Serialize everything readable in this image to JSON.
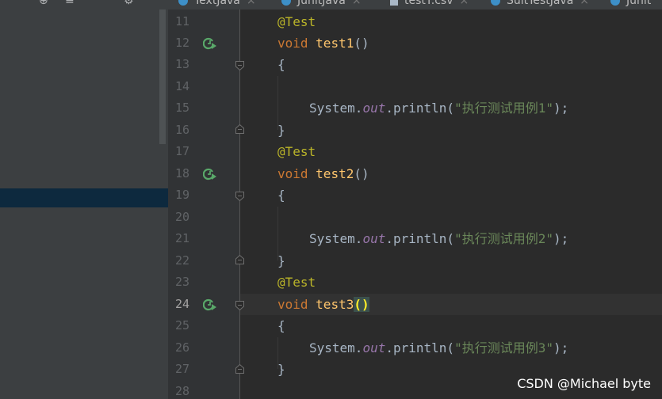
{
  "tabs": [
    {
      "label": "TextJava",
      "icon": "class-icon"
    },
    {
      "label": "JunitJava",
      "icon": "class-icon",
      "active": true
    },
    {
      "label": "testT.csv",
      "icon": "file-icon"
    },
    {
      "label": "SuitTestJava",
      "icon": "class-icon"
    },
    {
      "label": "Junit",
      "icon": "class-icon"
    }
  ],
  "toolbar_icons": [
    "globe-icon",
    "collapse-icon",
    "expand-icon",
    "settings-icon"
  ],
  "lines": [
    {
      "num": "11"
    },
    {
      "num": "12"
    },
    {
      "num": "13"
    },
    {
      "num": "14"
    },
    {
      "num": "15"
    },
    {
      "num": "16"
    },
    {
      "num": "17"
    },
    {
      "num": "18"
    },
    {
      "num": "19"
    },
    {
      "num": "20"
    },
    {
      "num": "21"
    },
    {
      "num": "22"
    },
    {
      "num": "23"
    },
    {
      "num": "24"
    },
    {
      "num": "25"
    },
    {
      "num": "26"
    },
    {
      "num": "27"
    },
    {
      "num": "28"
    }
  ],
  "code": {
    "annotation": "@Test",
    "void_kw": "void",
    "method1": "test1",
    "method2": "test2",
    "method3": "test3",
    "parens": "()",
    "open_brace": "{",
    "close_brace": "}",
    "system": "System",
    "dot": ".",
    "out": "out",
    "println": "println",
    "open_paren": "(",
    "close_paren_semi": ");",
    "str1": "\"执行测试用例1\"",
    "str2": "\"执行测试用例2\"",
    "str3": "\"执行测试用例3\""
  },
  "current_line": "24",
  "watermark": "CSDN @Michael byte",
  "colors": {
    "background": "#2b2b2b",
    "keyword": "#cc7832",
    "annotation": "#bbb529",
    "method": "#ffc66d",
    "string": "#6a8759",
    "static_field": "#9876aa",
    "run_icon": "#59a869"
  }
}
